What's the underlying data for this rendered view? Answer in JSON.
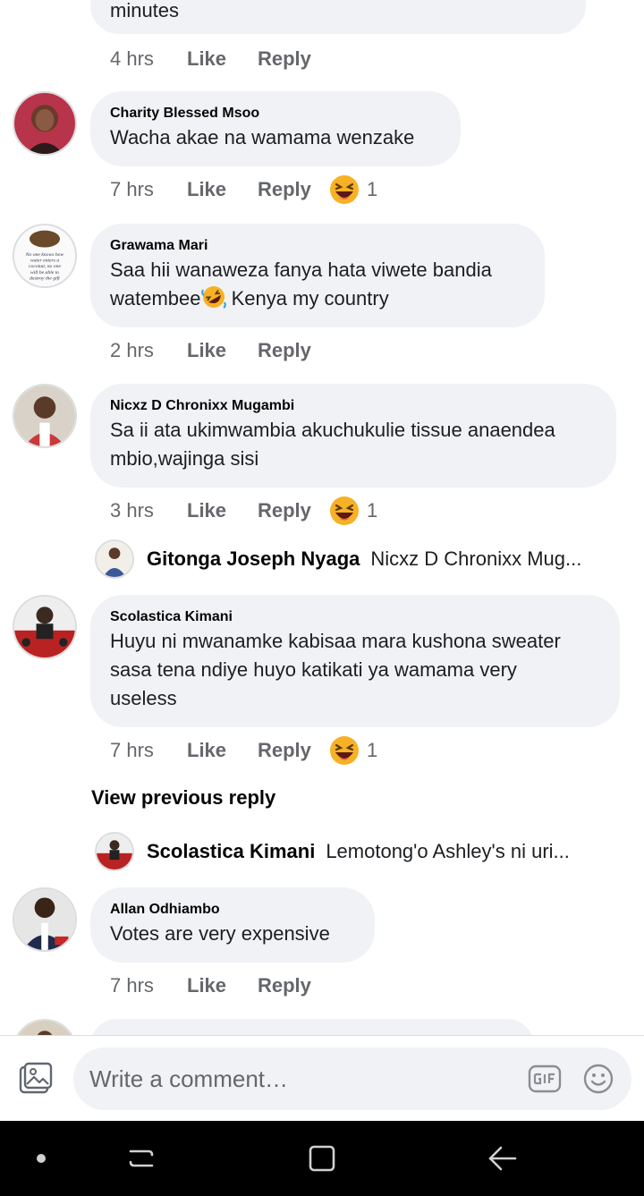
{
  "comments": [
    {
      "id": "c0",
      "name": "",
      "text": "minutes",
      "time": "4 hrs",
      "like": "Like",
      "reply": "Reply",
      "reactions": ""
    },
    {
      "id": "c1",
      "name": "Charity Blessed Msoo",
      "text": "Wacha akae na wamama wenzake",
      "time": "7 hrs",
      "like": "Like",
      "reply": "Reply",
      "reactions": "1"
    },
    {
      "id": "c2",
      "name": "Grawama Mari",
      "text_line1": "Saa hii wanaweza fanya hata viwete bandia",
      "text_line2": "watembee",
      "text_line2b": " Kenya my country",
      "time": "2 hrs",
      "like": "Like",
      "reply": "Reply",
      "reactions": ""
    },
    {
      "id": "c3",
      "name": "Nicxz D Chronixx Mugambi",
      "text_line1": "Sa ii ata ukimwambia akuchukulie tissue anaendea",
      "text_line2": "mbio,wajinga sisi",
      "time": "3 hrs",
      "like": "Like",
      "reply": "Reply",
      "reactions": "1"
    },
    {
      "id": "c4",
      "name": "Scolastica Kimani",
      "text_line1": "Huyu ni mwanamke kabisaa mara kushona sweater",
      "text_line2": "sasa tena ndiye huyo katikati ya wamama very",
      "text_line3": "useless",
      "time": "7 hrs",
      "like": "Like",
      "reply": "Reply",
      "reactions": "1"
    },
    {
      "id": "c5",
      "name": "Allan Odhiambo",
      "text": "Votes are very expensive",
      "time": "7 hrs",
      "like": "Like",
      "reply": "Reply",
      "reactions": ""
    }
  ],
  "avatar_text": {
    "grawama": "No one knows how water enters a coconut, no one will be able to destroy the gift"
  },
  "sub_replies": [
    {
      "name": "Gitonga Joseph Nyaga",
      "text": "Nicxz D Chronixx Mug..."
    },
    {
      "name": "Scolastica Kimani",
      "text": "Lemotong'o Ashley's ni uri..."
    }
  ],
  "view_previous": "View previous reply",
  "composer": {
    "placeholder": "Write a comment…",
    "icons": [
      "photo-icon",
      "gif-icon",
      "smile-icon"
    ]
  },
  "reaction_emoji": "haha-emoji",
  "colors": {
    "bubble": "#f0f2f5",
    "secondary_text": "#65676b",
    "primary_text": "#050505",
    "nav_bg": "#000000"
  }
}
